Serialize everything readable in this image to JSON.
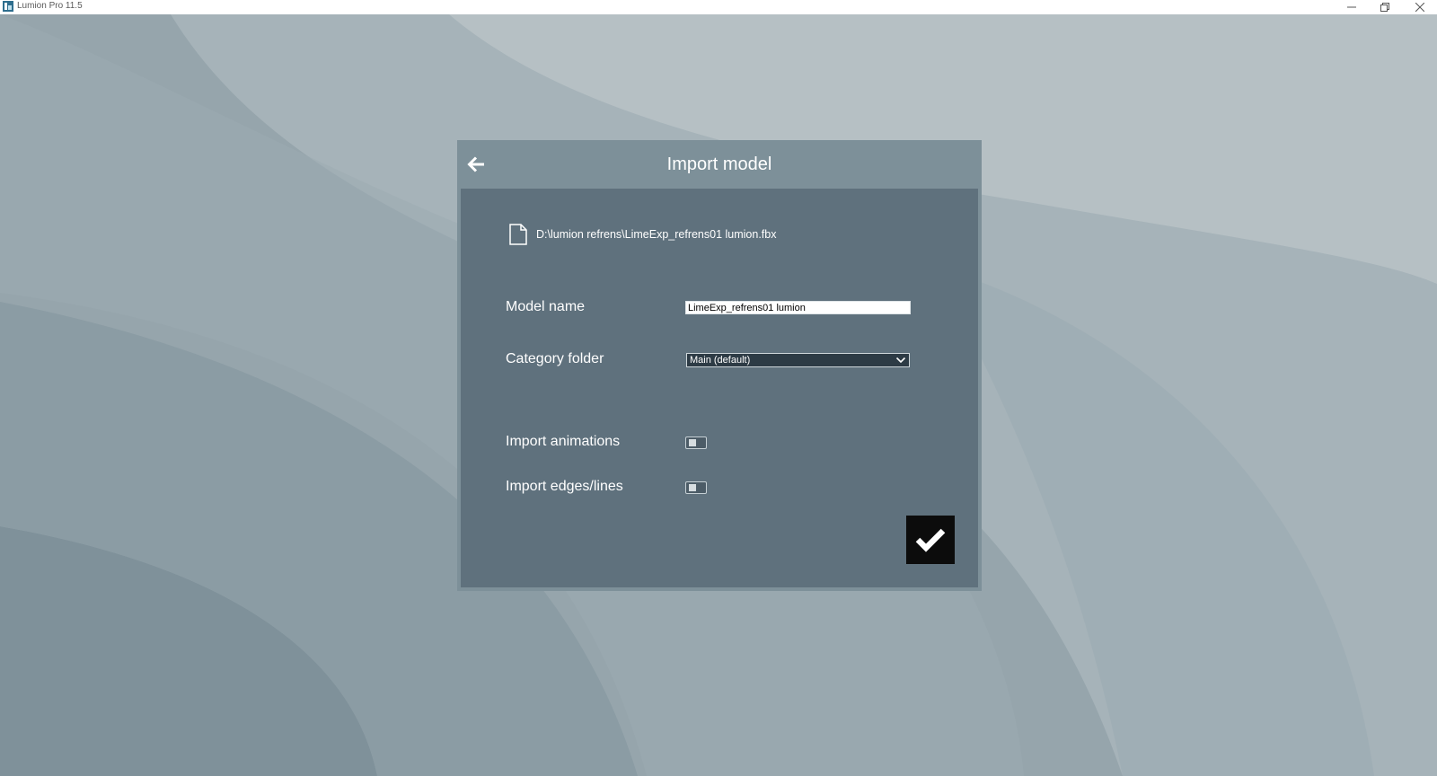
{
  "window": {
    "title": "Lumion Pro 11.5"
  },
  "dialog": {
    "title": "Import model",
    "file_path": "D:\\lumion refrens\\LimeExp_refrens01 lumion.fbx",
    "model_name_label": "Model name",
    "model_name_value": "LimeExp_refrens01 lumion",
    "category_label": "Category folder",
    "category_value": "Main (default)",
    "import_animations_label": "Import animations",
    "import_animations_on": false,
    "import_edges_label": "Import edges/lines",
    "import_edges_on": false
  },
  "icons": {
    "app": "lumion-app-icon",
    "minimize": "minimize-icon",
    "restore": "restore-icon",
    "close": "close-icon",
    "back": "arrow-left-icon",
    "file": "file-icon",
    "dropdown": "chevron-down-icon",
    "confirm": "checkmark-icon"
  },
  "colors": {
    "dialog_header": "#7d9099",
    "dialog_body": "#5f717d",
    "confirm_button": "#0c0c0c",
    "background": "#a3b0b6"
  }
}
